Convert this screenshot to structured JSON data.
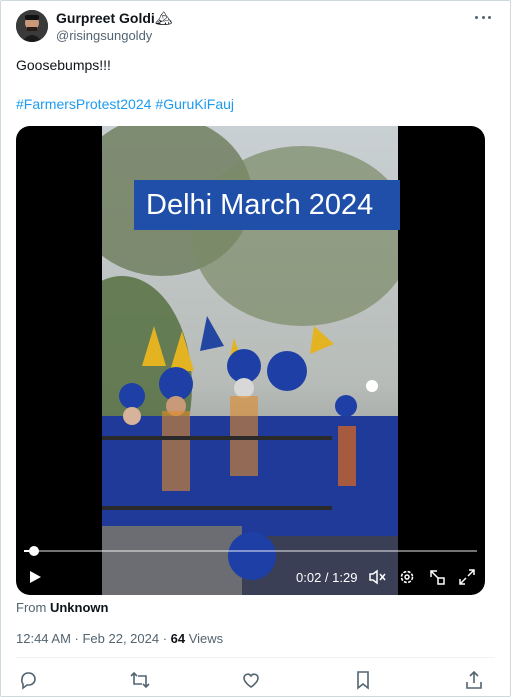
{
  "author": {
    "name": "Gurpreet Goldi",
    "name_emoji": "🏔",
    "handle": "@risingsungoldy"
  },
  "tweet": {
    "text": "Goosebumps!!!",
    "hashtags": [
      "#FarmersProtest2024",
      "#GuruKiFauj"
    ]
  },
  "media": {
    "overlay_text": "Delhi March 2024",
    "time_display": "0:02 / 1:29",
    "progress": 0.022,
    "icons": [
      "play-icon",
      "volume-muted-icon",
      "settings-gear-icon",
      "pip-icon",
      "fullscreen-icon"
    ]
  },
  "source": {
    "label": "From",
    "value": "Unknown"
  },
  "meta": {
    "timestamp": "12:44 AM · Feb 22, 2024 · ",
    "views_count": "64",
    "views_label": " Views"
  },
  "actions": [
    "reply-icon",
    "retweet-icon",
    "like-icon",
    "bookmark-icon",
    "share-icon"
  ],
  "colors": {
    "link": "#1d9bf0",
    "secondary_text": "#536471",
    "banner": "#1f4fa8"
  }
}
